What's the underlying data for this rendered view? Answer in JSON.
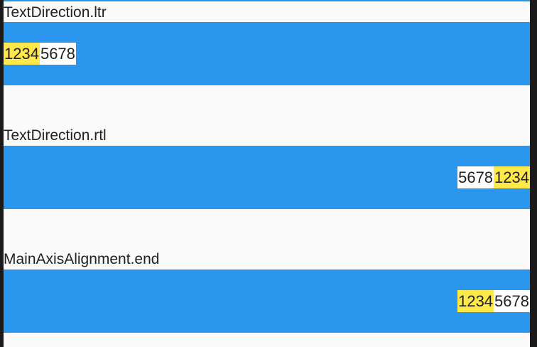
{
  "sections": [
    {
      "label": "TextDirection.ltr",
      "first": "1234",
      "second": "5678"
    },
    {
      "label": "TextDirection.rtl",
      "first": "5678",
      "second": "1234"
    },
    {
      "label": "MainAxisAlignment.end",
      "first": "1234",
      "second": "5678"
    }
  ],
  "colors": {
    "band": "#2a96ee",
    "highlight": "#ffe84a",
    "background": "#fafafa"
  }
}
